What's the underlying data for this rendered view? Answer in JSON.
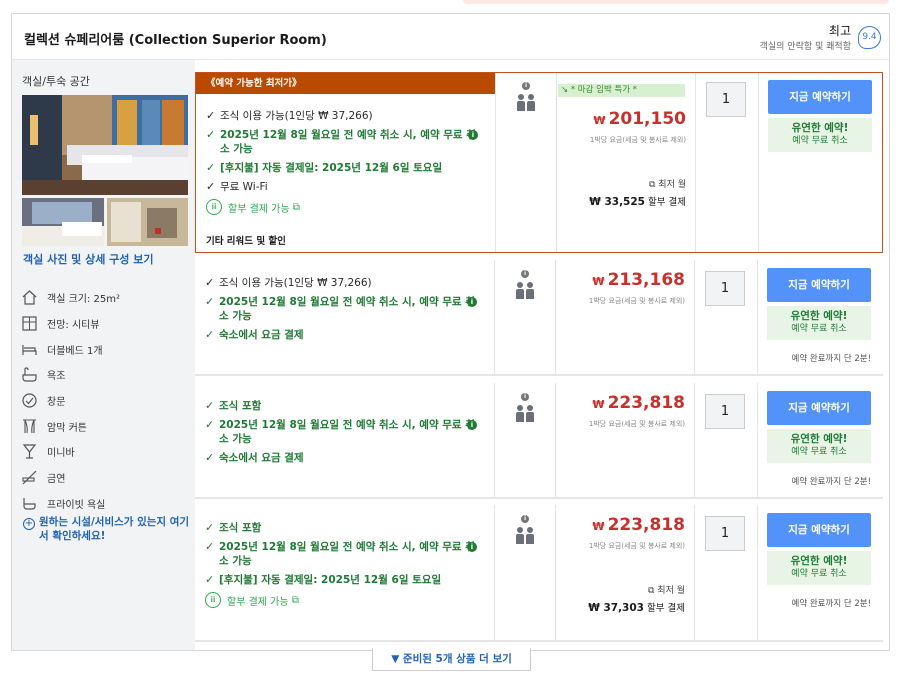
{
  "header": {
    "room_title": "컬렉션 슈페리어룸 (Collection Superior Room)",
    "rating_word": "최고",
    "rating_sub": "객실의 안락함 및 쾌적함",
    "rating_score": "9.4"
  },
  "left": {
    "title": "객실/투숙 공간",
    "photo_link": "객실 사진 및 상세 구성 보기",
    "amenities": [
      {
        "icon": "room-size-icon",
        "label": "객실 크기: 25m²"
      },
      {
        "icon": "view-icon",
        "label": "전망: 시티뷰"
      },
      {
        "icon": "bed-icon",
        "label": "더블베드 1개"
      },
      {
        "icon": "bathtub-icon",
        "label": "욕조"
      },
      {
        "icon": "window-icon",
        "label": "창문"
      },
      {
        "icon": "curtain-icon",
        "label": "암막 커튼"
      },
      {
        "icon": "minibar-icon",
        "label": "미니바"
      },
      {
        "icon": "no-smoking-icon",
        "label": "금연"
      },
      {
        "icon": "bath-icon",
        "label": "프라이빗 욕실"
      }
    ],
    "more_link": "원하는 시설/서비스가 있는지 여기서 확인하세요!"
  },
  "offers": [
    {
      "ribbon": "《예약 가능한 최저가》",
      "features": [
        {
          "text": "조식 이용 가능(1인당 ₩ 37,266)",
          "style": "dark"
        },
        {
          "text": "2025년 12월 8일 월요일 전 예약 취소 시, 예약 무료 취소 가능",
          "style": "green"
        },
        {
          "text": "[후지불] 자동 결제일: 2025년 12월 6일 토요일",
          "style": "green"
        },
        {
          "text": "무료 Wi-Fi",
          "style": "dark"
        }
      ],
      "installment": "할부 결제 가능",
      "other": "기타 리워드 및 할인",
      "lastmin": "↘ * 마감 임박 특가 *",
      "currency": "₩",
      "price": "201,150",
      "price_sub": "1박당 요금(세금 및 봉사료 제외)",
      "ins_label": "최저 월",
      "ins_amount": "₩ 33,525",
      "ins_suffix": "할부 결제",
      "qty": "1",
      "book": "지금 예약하기",
      "flex_title": "유연한 예약!",
      "flex_sub": "예약 무료 취소",
      "note": ""
    },
    {
      "features": [
        {
          "text": "조식 이용 가능(1인당 ₩ 37,266)",
          "style": "dark"
        },
        {
          "text": "2025년 12월 8일 월요일 전 예약 취소 시, 예약 무료 취소 가능",
          "style": "green"
        },
        {
          "text": "숙소에서 요금 결제",
          "style": "green"
        }
      ],
      "currency": "₩",
      "price": "213,168",
      "price_sub": "1박당 요금(세금 및 봉사료 제외)",
      "qty": "1",
      "book": "지금 예약하기",
      "flex_title": "유연한 예약!",
      "flex_sub": "예약 무료 취소",
      "note": "예약 완료까지 단 2분!"
    },
    {
      "features": [
        {
          "text": "조식 포함",
          "style": "green"
        },
        {
          "text": "2025년 12월 8일 월요일 전 예약 취소 시, 예약 무료 취소 가능",
          "style": "green"
        },
        {
          "text": "숙소에서 요금 결제",
          "style": "green"
        }
      ],
      "currency": "₩",
      "price": "223,818",
      "price_sub": "1박당 요금(세금 및 봉사료 제외)",
      "qty": "1",
      "book": "지금 예약하기",
      "flex_title": "유연한 예약!",
      "flex_sub": "예약 무료 취소",
      "note": "예약 완료까지 단 2분!"
    },
    {
      "features": [
        {
          "text": "조식 포함",
          "style": "green"
        },
        {
          "text": "2025년 12월 8일 월요일 전 예약 취소 시, 예약 무료 취소 가능",
          "style": "green"
        },
        {
          "text": "[후지불] 자동 결제일: 2025년 12월 6일 토요일",
          "style": "green"
        }
      ],
      "installment": "할부 결제 가능",
      "currency": "₩",
      "price": "223,818",
      "price_sub": "1박당 요금(세금 및 봉사료 제외)",
      "ins_label": "최저 월",
      "ins_amount": "₩ 37,303",
      "ins_suffix": "할부 결제",
      "qty": "1",
      "book": "지금 예약하기",
      "flex_title": "유연한 예약!",
      "flex_sub": "예약 무료 취소",
      "note": "예약 완료까지 단 2분!"
    }
  ],
  "more_button": "▼ 준비된 5개 상품 더 보기",
  "colors": {
    "accent": "#5392f9",
    "price": "#c7302b",
    "green": "#1e7a34",
    "ribbon": "#b94a00"
  }
}
